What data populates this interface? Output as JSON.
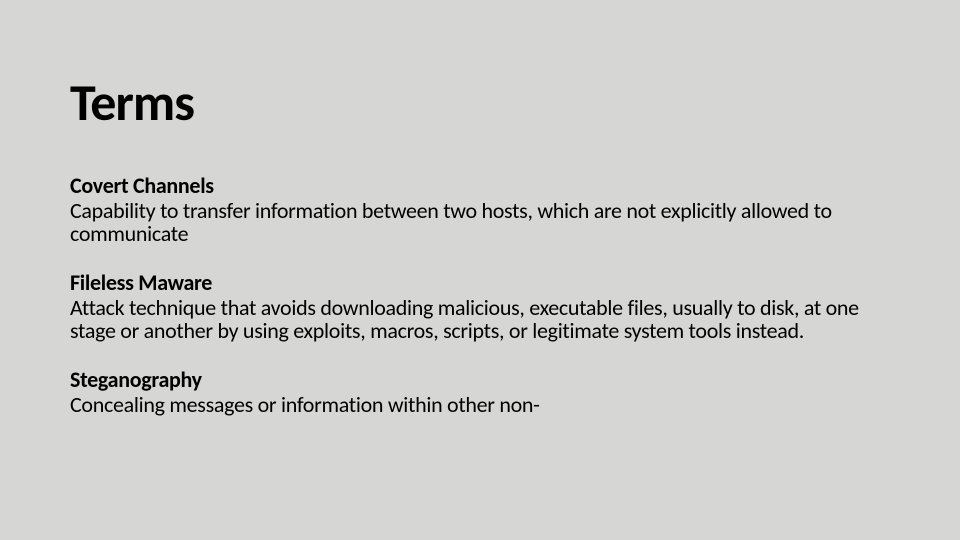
{
  "title": "Terms",
  "terms": [
    {
      "name": "Covert Channels",
      "definition": "Capability to transfer information between two hosts, which are not explicitly allowed to communicate"
    },
    {
      "name": "Fileless Maware",
      "definition": "Attack technique that avoids downloading malicious, executable files, usually to disk, at one stage or another by using exploits, macros, scripts, or legitimate system tools instead."
    },
    {
      "name": "Steganography",
      "definition": "Concealing messages or information within other non-"
    }
  ]
}
